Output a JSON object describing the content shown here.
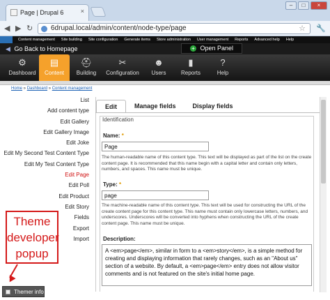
{
  "browser": {
    "tab_title": "Page | Drupal 6",
    "tab_close": "×",
    "url": "6drupal.local/admin/content/node-type/page",
    "back": "◀",
    "forward": "▶",
    "reload": "↻",
    "star": "☆",
    "wrench": "🔧",
    "win_min": "–",
    "win_max": "□",
    "win_close": "×"
  },
  "admin_menu": [
    "Content management",
    "Site building",
    "Site configuration",
    "Generate items",
    "Store administration",
    "User management",
    "Reports",
    "Advanced help",
    "Help"
  ],
  "gobar": {
    "back_label": "Go Back to Homepage",
    "open_panel": "Open Panel"
  },
  "toolbar": [
    {
      "label": "Dashboard",
      "icon": "⚙",
      "icon_name": "gear-icon"
    },
    {
      "label": "Content",
      "icon": "▤",
      "icon_name": "document-icon",
      "active": true
    },
    {
      "label": "Building",
      "icon": "⛑",
      "icon_name": "hardhat-icon"
    },
    {
      "label": "Configuration",
      "icon": "✂",
      "icon_name": "tools-icon"
    },
    {
      "label": "Users",
      "icon": "☻",
      "icon_name": "users-icon"
    },
    {
      "label": "Reports",
      "icon": "▮",
      "icon_name": "chart-icon"
    },
    {
      "label": "Help",
      "icon": "?",
      "icon_name": "help-icon"
    }
  ],
  "breadcrumb": {
    "home": "Home",
    "sep1": " » ",
    "dashboard": "Dashboard",
    "sep2": " » ",
    "content": "Content management"
  },
  "leftlist": [
    "List",
    "Add content type",
    "Edit Gallery",
    "Edit Gallery Image",
    "Edit Joke",
    "Edit My Second Test Content Type",
    "Edit My Test Content Type",
    "Edit Page",
    "Edit Poll",
    "Edit Product",
    "Edit Story",
    "Fields",
    "Export",
    "Import"
  ],
  "tabs": [
    "Edit",
    "Manage fields",
    "Display fields"
  ],
  "form": {
    "legend": "Identification",
    "name_label": "Name:",
    "required": "*",
    "name_value": "Page",
    "name_desc": "The human-readable name of this content type. This text will be displayed as part of the list on the create content page. It is recommended that this name begin with a capital letter and contain only letters, numbers, and spaces. This name must be unique.",
    "type_label": "Type:",
    "type_value": "page",
    "type_desc": "The machine-readable name of this content type. This text will be used for constructing the URL of the create content page for this content type. This name must contain only lowercase letters, numbers, and underscores. Underscores will be converted into hyphens when constructing the URL of the create content page. This name must be unique.",
    "description_label": "Description:",
    "description_value": "A <em>page</em>, similar in form to a <em>story</em>, is a simple method for creating and displaying information that rarely changes, such as an \"About us\" section of a website. By default, a <em>page</em> entry does not allow visitor comments and is not featured on the site's initial home page."
  },
  "popup": {
    "line1": "Theme",
    "line2": "developer",
    "line3": "popup"
  },
  "themer_info": "Themer info",
  "colors": {
    "accent": "#f5a12b",
    "link": "#1a5fb4",
    "active_item": "#d01010",
    "popup": "#d41818"
  }
}
